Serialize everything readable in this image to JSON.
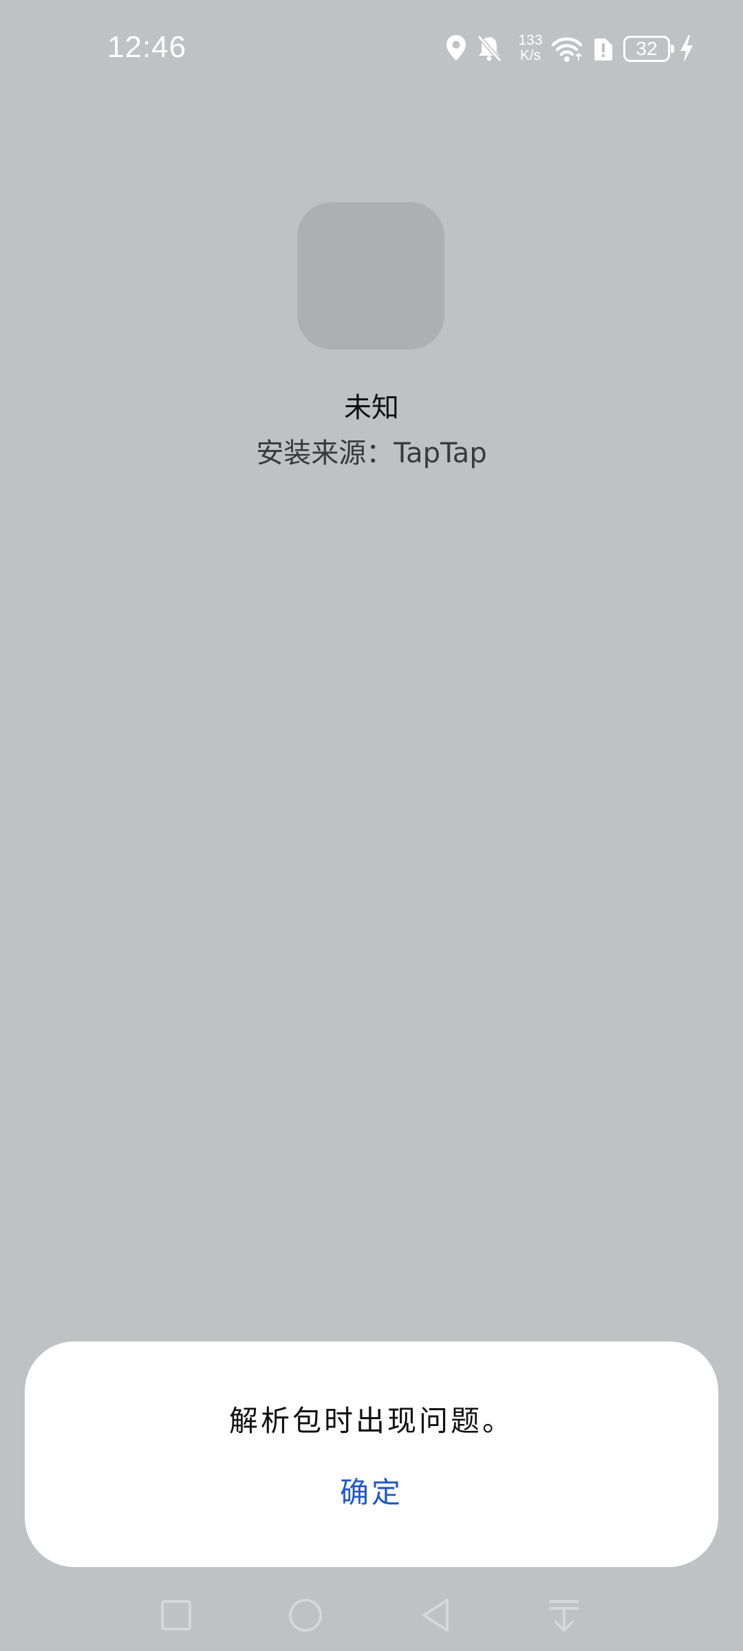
{
  "status_bar": {
    "time": "12:46",
    "network_speed_value": "133",
    "network_speed_unit": "K/s",
    "battery_level": "32",
    "icons": [
      "location-icon",
      "bell-muted-icon",
      "wifi-icon",
      "alert-icon",
      "battery-icon",
      "charging-icon"
    ]
  },
  "app": {
    "name": "未知",
    "install_source": "安装来源：TapTap"
  },
  "dialog": {
    "message": "解析包时出现问题。",
    "confirm_label": "确定"
  },
  "nav_bar": {
    "icons": [
      "recent-apps-icon",
      "home-icon",
      "back-icon",
      "hide-nav-icon"
    ]
  },
  "colors": {
    "background": "#c0c1c3",
    "accent": "#2358c4",
    "dialog_bg": "#ffffff",
    "icon_placeholder": "#aeafb1"
  }
}
